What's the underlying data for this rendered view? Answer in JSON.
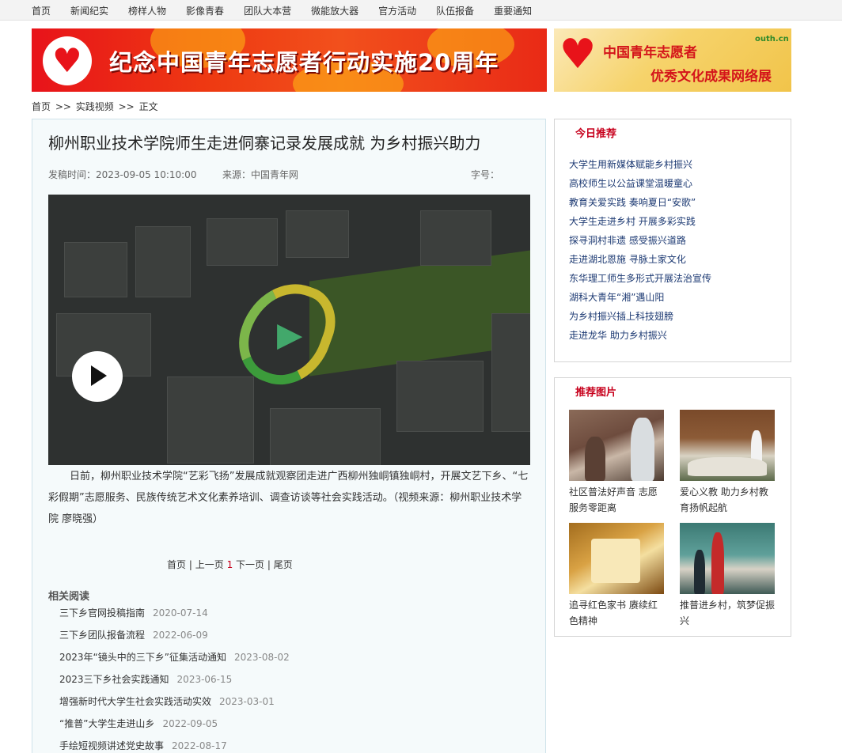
{
  "nav": {
    "items": [
      "首页",
      "新闻纪实",
      "榜样人物",
      "影像青春",
      "团队大本营",
      "微能放大器",
      "官方活动",
      "队伍报备",
      "重要通知"
    ]
  },
  "banner_main": {
    "title": "纪念中国青年志愿者行动实施20周年"
  },
  "banner_side": {
    "line1": "中国青年志愿者",
    "line2": "优秀文化成果网络展",
    "logo_text": "outh.cn"
  },
  "breadcrumb": {
    "home": "首页",
    "sep1": ">>",
    "section": "实践视频",
    "sep2": ">>",
    "current": "正文"
  },
  "article": {
    "title": "柳州职业技术学院师生走进侗寨记录发展成就 为乡村振兴助力",
    "publish_time": "发稿时间：2023-09-05 10:10:00",
    "source": "来源：中国青年网",
    "font_size_label": "字号：",
    "lead": "日前，柳州职业技术学院“艺彩飞扬”发展成就观察团走进广西柳州独峒镇独峒村，开展文艺下乡、“七彩假期”志愿服务、民族传统艺术文化素养培训、调查访谈等社会实践活动。（视频来源：柳州职业技术学院 廖晓强）"
  },
  "pager": {
    "first": "首页",
    "prev": "上一页",
    "current": "1",
    "next": "下一页",
    "last": "尾页",
    "sep": "|"
  },
  "related": {
    "title": "相关阅读",
    "items": [
      {
        "title": "三下乡官网投稿指南",
        "date": "2020-07-14"
      },
      {
        "title": "三下乡团队报备流程",
        "date": "2022-06-09"
      },
      {
        "title": "2023年“镜头中的三下乡”征集活动通知",
        "date": "2023-08-02"
      },
      {
        "title": "2023三下乡社会实践通知",
        "date": "2023-06-15"
      },
      {
        "title": "增强新时代大学生社会实践活动实效",
        "date": "2023-03-01"
      },
      {
        "title": "“推普”大学生走进山乡",
        "date": "2022-09-05"
      },
      {
        "title": "手绘短视频讲述党史故事",
        "date": "2022-08-17"
      }
    ]
  },
  "today": {
    "title": "今日推荐",
    "items": [
      "大学生用新媒体赋能乡村振兴",
      "高校师生以公益课堂温暖童心",
      "教育关爱实践 奏响夏日“安歌”",
      "大学生走进乡村 开展多彩实践",
      "探寻洞村非遗 感受振兴道路",
      "走进湖北恩施 寻脉土家文化",
      "东华理工师生多形式开展法治宣传",
      "湖科大青年“湘”遇山阳",
      "为乡村振兴插上科技翅膀",
      "走进龙华 助力乡村振兴"
    ]
  },
  "pictures": {
    "title": "推荐图片",
    "items": [
      "社区普法好声音 志愿服务零距离",
      "爱心义教 助力乡村教育扬帆起航",
      "追寻红色家书 赓续红色精神",
      "推普进乡村，筑梦促振兴"
    ]
  }
}
